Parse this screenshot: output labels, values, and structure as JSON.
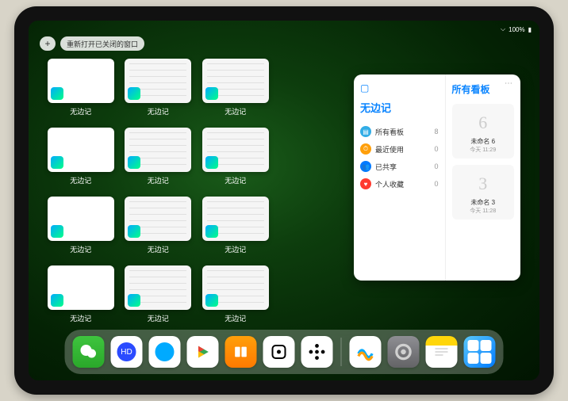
{
  "status": {
    "battery": "100%",
    "wifi": "⌁"
  },
  "topbar": {
    "plus": "+",
    "reopen_label": "重新打开已关闭的窗口"
  },
  "grid": {
    "app_label": "无边记",
    "items": [
      {
        "blank": true
      },
      {
        "blank": false
      },
      {
        "blank": false
      },
      {
        "blank": true
      },
      {
        "blank": false
      },
      {
        "blank": false
      },
      {
        "blank": true
      },
      {
        "blank": false
      },
      {
        "blank": false
      },
      {
        "blank": true
      },
      {
        "blank": false
      },
      {
        "blank": false
      }
    ]
  },
  "panel": {
    "left_title": "无边记",
    "right_title": "所有看板",
    "categories": [
      {
        "icon_color": "#32ade6",
        "glyph": "▤",
        "label": "所有看板",
        "count": "8"
      },
      {
        "icon_color": "#ff9f0a",
        "glyph": "⏱",
        "label": "最近使用",
        "count": "0"
      },
      {
        "icon_color": "#007aff",
        "glyph": "👥",
        "label": "已共享",
        "count": "0"
      },
      {
        "icon_color": "#ff3b30",
        "glyph": "♥",
        "label": "个人收藏",
        "count": "0"
      }
    ],
    "boards": [
      {
        "sketch": "6",
        "name": "未命名 6",
        "meta": "今天 11:29"
      },
      {
        "sketch": "3",
        "name": "未命名 3",
        "meta": "今天 11:28"
      }
    ]
  },
  "dock": {
    "apps": [
      "wechat",
      "blue1",
      "blue2",
      "play",
      "books",
      "dice",
      "hex"
    ],
    "recent": [
      "freeform",
      "settings",
      "notes",
      "folder"
    ]
  }
}
